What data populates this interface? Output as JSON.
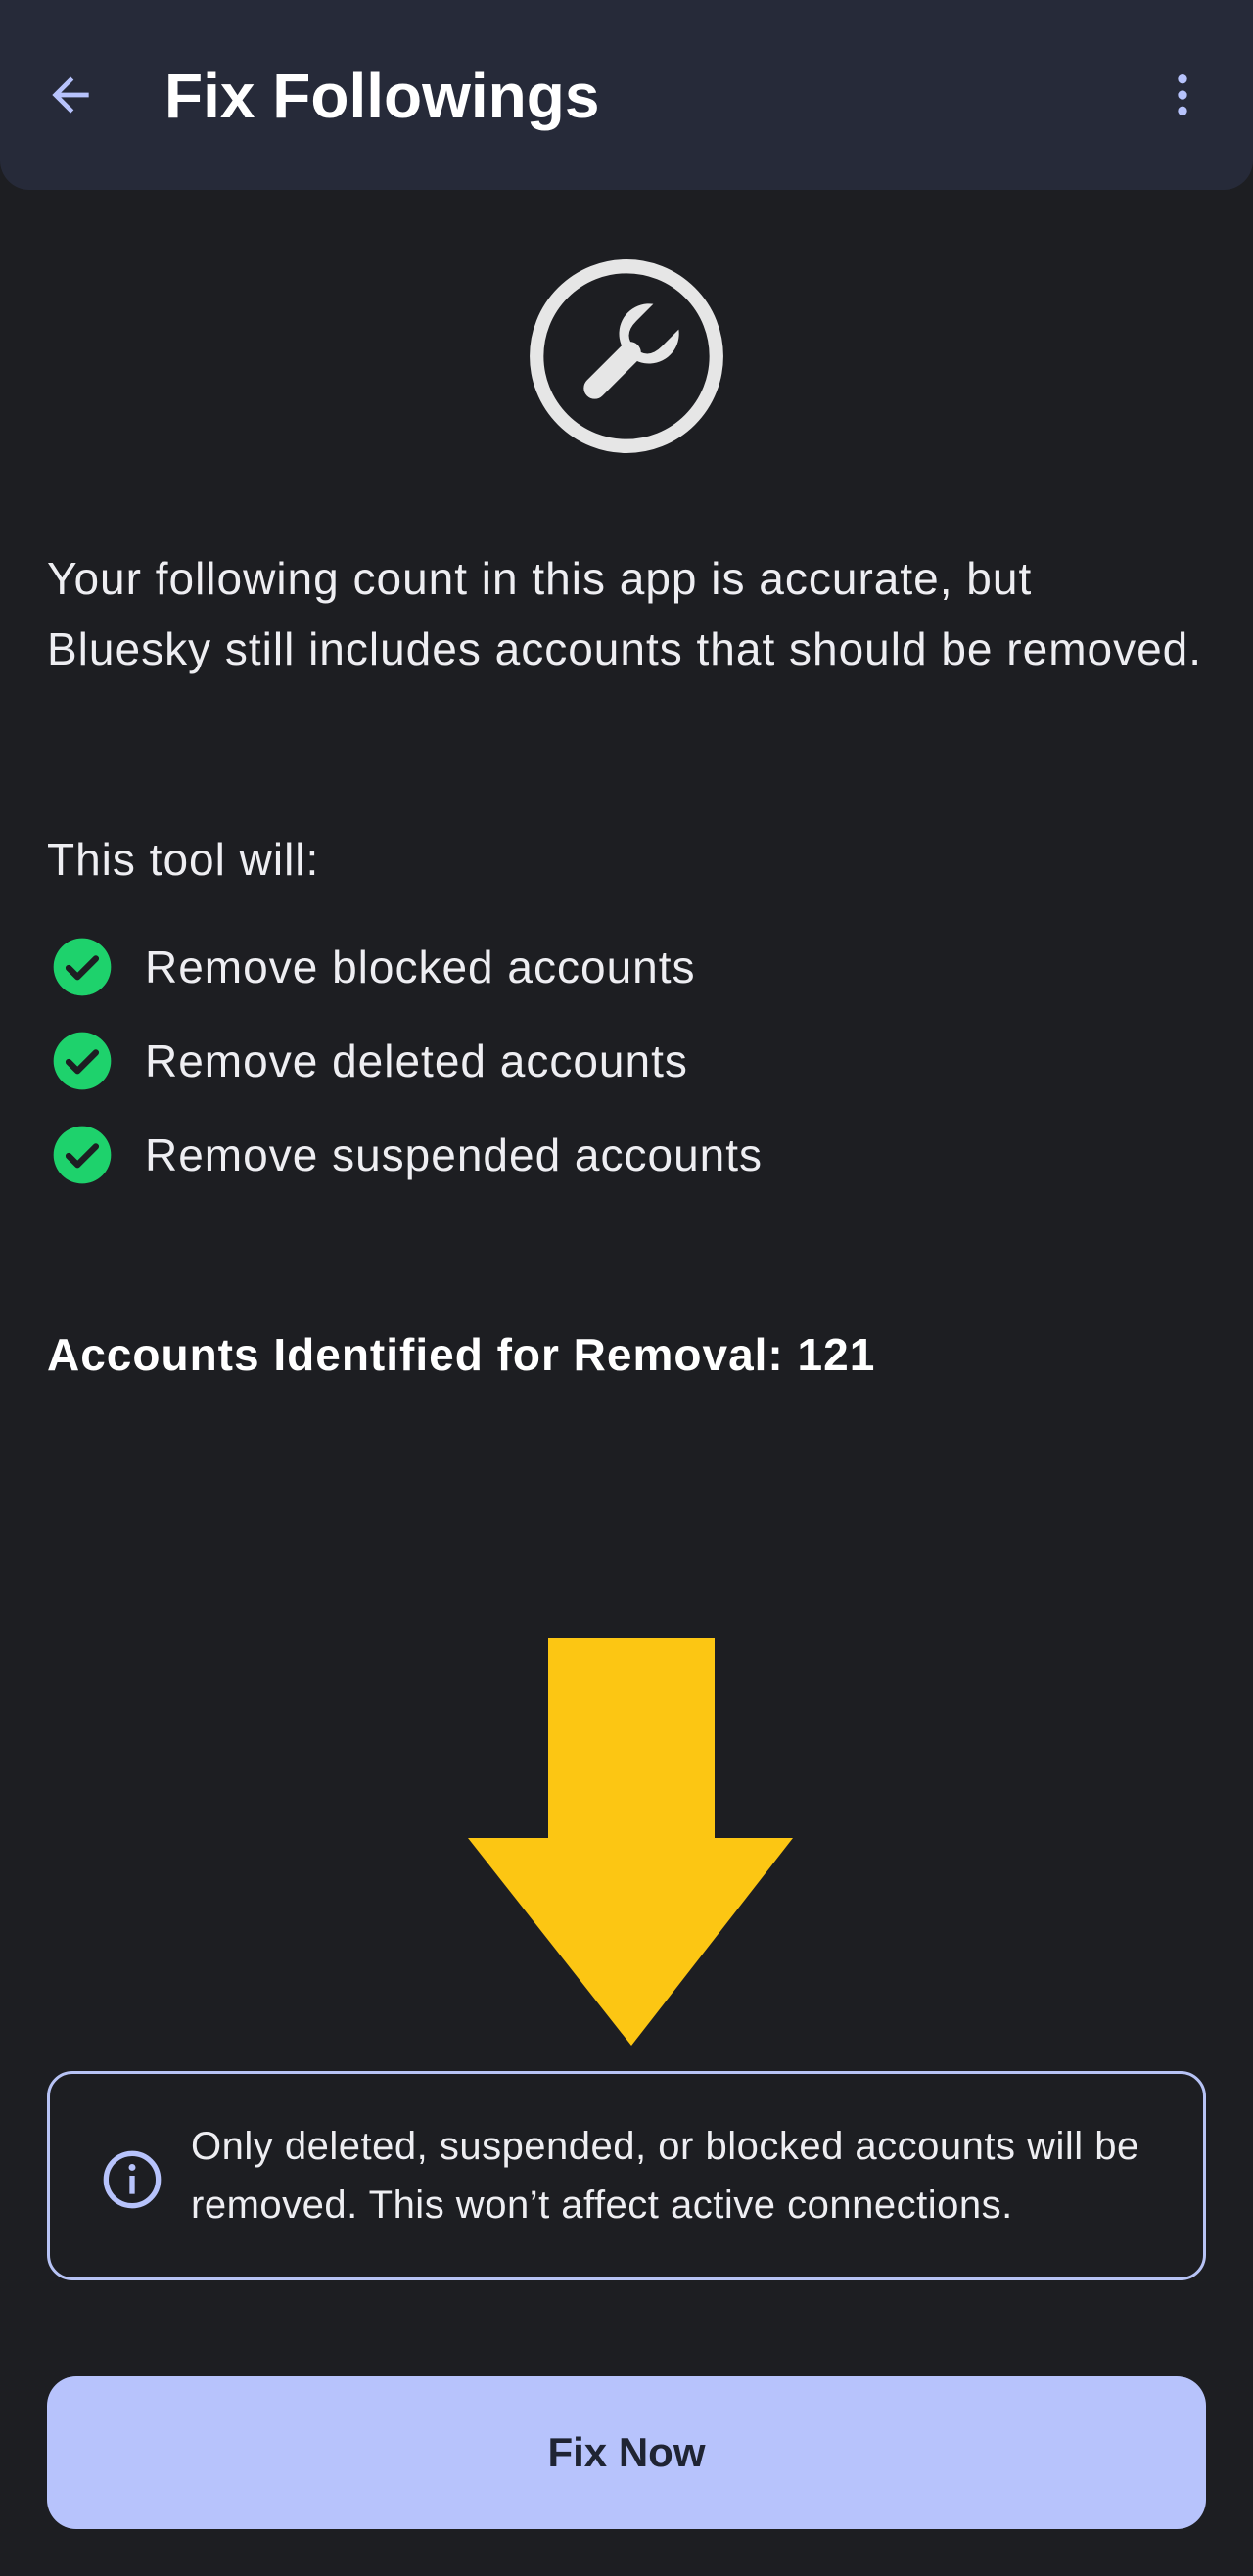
{
  "app_bar": {
    "title": "Fix Followings",
    "back_icon": "arrow-back-icon",
    "menu_icon": "more-vert-icon"
  },
  "hero": {
    "icon": "wrench-circle-icon"
  },
  "description": "Your following count in this app is accurate, but Bluesky still includes accounts that should be removed.",
  "tool_intro": "This tool will:",
  "checklist": [
    {
      "icon": "check-circle-icon",
      "label": "Remove blocked accounts"
    },
    {
      "icon": "check-circle-icon",
      "label": "Remove deleted accounts"
    },
    {
      "icon": "check-circle-icon",
      "label": "Remove suspended accounts"
    }
  ],
  "removal_count": "Accounts Identified for Removal: 121",
  "annotation": {
    "icon": "down-arrow-icon",
    "color": "#fcc613"
  },
  "info_box": {
    "icon": "info-icon",
    "text": "Only deleted, suspended, or blocked accounts will be removed. This won’t affect active connections."
  },
  "primary_button": {
    "label": "Fix Now"
  },
  "colors": {
    "background": "#1d1e22",
    "app_bar": "#262a39",
    "accent": "#b7c3fc",
    "check_green": "#1ed26c",
    "arrow_yellow": "#fcc613"
  }
}
